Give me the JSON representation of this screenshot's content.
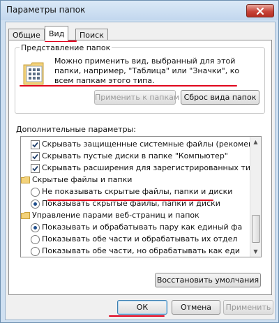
{
  "window": {
    "title": "Параметры папок",
    "close_icon": "close-icon"
  },
  "tabs": [
    {
      "label": "Общие"
    },
    {
      "label": "Вид"
    },
    {
      "label": "Поиск"
    }
  ],
  "folder_view": {
    "legend": "Представление папок",
    "description": "Можно применить вид, выбранный для этой папки, например, \"Таблица\" или \"Значки\", ко всем папкам этого типа.",
    "apply_button": "Применить к папкам",
    "reset_button": "Сброс вида папок"
  },
  "advanced": {
    "label": "Дополнительные параметры:",
    "items": [
      {
        "kind": "checkbox",
        "checked": true,
        "text": "Скрывать защищенные системные файлы (рекомен..."
      },
      {
        "kind": "checkbox",
        "checked": true,
        "text": "Скрывать пустые диски в папке \"Компьютер\""
      },
      {
        "kind": "checkbox",
        "checked": true,
        "text": "Скрывать расширения для зарегистрированных типо"
      },
      {
        "kind": "folder",
        "text": "Скрытые файлы и папки"
      },
      {
        "kind": "radio",
        "checked": false,
        "text": "Не показывать скрытые файлы, папки и диски"
      },
      {
        "kind": "radio",
        "checked": true,
        "text": "Показывать скрытые файлы, папки и диски"
      },
      {
        "kind": "folder",
        "text": "Управление парами веб-страниц и папок"
      },
      {
        "kind": "radio",
        "checked": true,
        "text": "Показывать и обрабатывать пару как единый фа"
      },
      {
        "kind": "radio",
        "checked": false,
        "text": "Показывать обе части и обрабатывать их отдел"
      },
      {
        "kind": "radio",
        "checked": false,
        "text": "Показывать обе части, но обрабатывать как еди"
      }
    ],
    "restore_button": "Восстановить умолчания"
  },
  "footer": {
    "ok_button": "ОК",
    "cancel_button": "Отмена",
    "apply_button": "Применить"
  },
  "colors": {
    "annotation_red": "#e0001b",
    "selected_radio": "#1f4e8c"
  }
}
